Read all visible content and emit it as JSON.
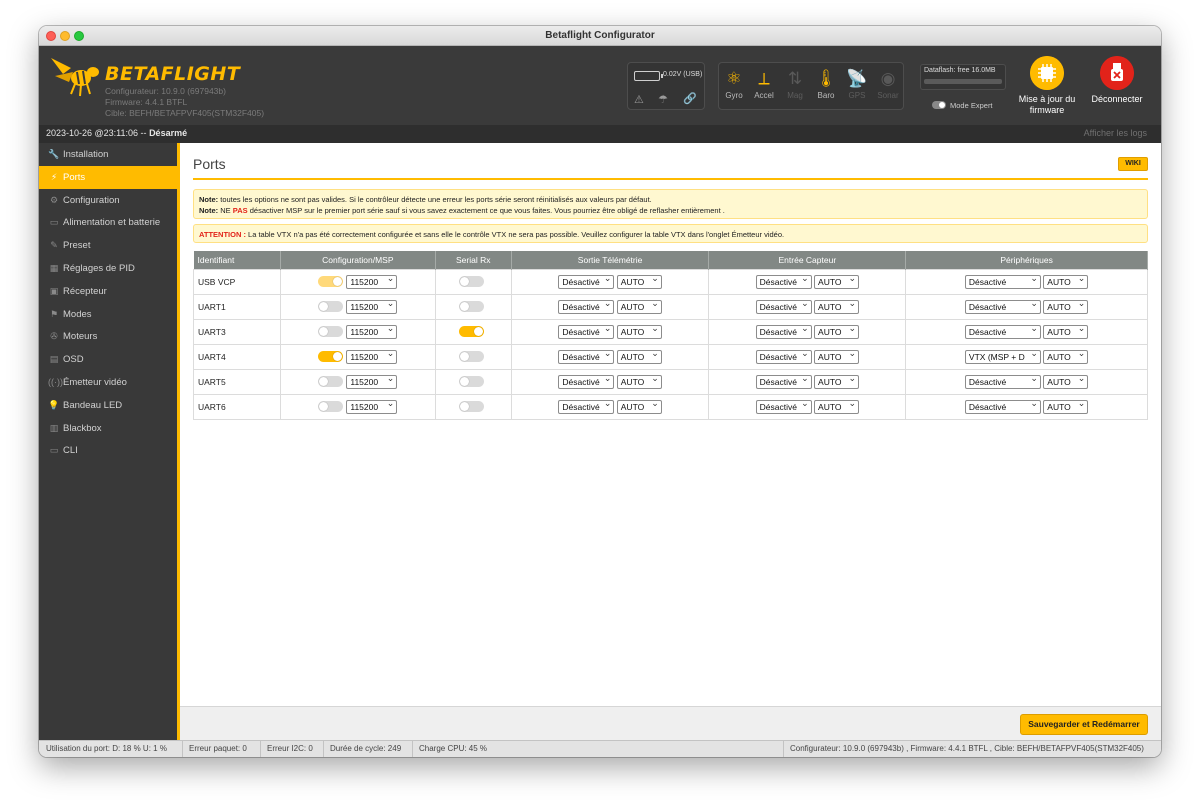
{
  "window": {
    "title": "Betaflight Configurator"
  },
  "header": {
    "logo_text": "BETAFLIGHT",
    "configurator_version": "Configurateur: 10.9.0 (697943b)",
    "firmware_version": "Firmware: 4.4.1 BTFL",
    "target": "Cible: BEFH/BETAFPVF405(STM32F405)",
    "battery": "0.02V (USB)",
    "sensors": [
      {
        "label": "Gyro",
        "icon": "gyro-icon",
        "active": true
      },
      {
        "label": "Accel",
        "icon": "accel-icon",
        "active": true
      },
      {
        "label": "Mag",
        "icon": "mag-icon",
        "active": false
      },
      {
        "label": "Baro",
        "icon": "baro-icon",
        "active": true
      },
      {
        "label": "GPS",
        "icon": "gps-icon",
        "active": false
      },
      {
        "label": "Sonar",
        "icon": "sonar-icon",
        "active": false
      }
    ],
    "dataflash": "Dataflash: free 16.0MB",
    "expert_mode": "Mode Expert",
    "flash_button": "Mise à jour du firmware",
    "disconnect_button": "Déconnecter"
  },
  "status_top": {
    "timestamp": "2023-10-26 @23:11:06 --",
    "arm_state": "Désarmé",
    "show_logs": "Afficher les logs"
  },
  "sidebar": {
    "items": [
      {
        "label": "Installation",
        "icon": "wrench-icon"
      },
      {
        "label": "Ports",
        "icon": "ports-icon",
        "active": true
      },
      {
        "label": "Configuration",
        "icon": "gear-icon"
      },
      {
        "label": "Alimentation et batterie",
        "icon": "battery-icon"
      },
      {
        "label": "Preset",
        "icon": "preset-icon"
      },
      {
        "label": "Réglages de PID",
        "icon": "pid-icon"
      },
      {
        "label": "Récepteur",
        "icon": "receiver-icon"
      },
      {
        "label": "Modes",
        "icon": "modes-icon"
      },
      {
        "label": "Moteurs",
        "icon": "motor-icon"
      },
      {
        "label": "OSD",
        "icon": "osd-icon"
      },
      {
        "label": "Émetteur vidéo",
        "icon": "vtx-icon"
      },
      {
        "label": "Bandeau LED",
        "icon": "led-icon"
      },
      {
        "label": "Blackbox",
        "icon": "blackbox-icon"
      },
      {
        "label": "CLI",
        "icon": "cli-icon"
      }
    ]
  },
  "page": {
    "title": "Ports",
    "wiki": "WIKI",
    "note1_label": "Note:",
    "note1_text": " toutes les options ne sont pas valides. Si le contrôleur détecte une erreur les ports série seront réinitialisés aux valeurs par défaut.",
    "note2_label": "Note:",
    "note2_pre": " NE ",
    "note2_emph": "PAS",
    "note2_text": " désactiver MSP sur le premier port série sauf si vous savez exactement ce que vous faites. Vous pourriez être obligé de reflasher entièrement .",
    "attention_label": "ATTENTION :",
    "attention_text": " La table VTX n'a pas été correctement configurée et sans elle le contrôle VTX ne sera pas possible. Veuillez configurer la table VTX dans l'onglet Émetteur vidéo.",
    "save_button": "Sauvegarder et Redémarrer"
  },
  "table": {
    "headers": [
      "Identifiant",
      "Configuration/MSP",
      "Serial Rx",
      "Sortie Télémétrie",
      "Entrée Capteur",
      "Périphériques"
    ],
    "rows": [
      {
        "id": "USB VCP",
        "msp": true,
        "msp_locked": true,
        "baud": "115200",
        "rx": false,
        "telemetry": "Désactivé",
        "telemetry_baud": "AUTO",
        "sensor": "Désactivé",
        "sensor_baud": "AUTO",
        "peripheral": "Désactivé",
        "peripheral_baud": "AUTO"
      },
      {
        "id": "UART1",
        "msp": false,
        "msp_locked": false,
        "baud": "115200",
        "rx": false,
        "telemetry": "Désactivé",
        "telemetry_baud": "AUTO",
        "sensor": "Désactivé",
        "sensor_baud": "AUTO",
        "peripheral": "Désactivé",
        "peripheral_baud": "AUTO"
      },
      {
        "id": "UART3",
        "msp": false,
        "msp_locked": false,
        "baud": "115200",
        "rx": true,
        "telemetry": "Désactivé",
        "telemetry_baud": "AUTO",
        "sensor": "Désactivé",
        "sensor_baud": "AUTO",
        "peripheral": "Désactivé",
        "peripheral_baud": "AUTO"
      },
      {
        "id": "UART4",
        "msp": true,
        "msp_locked": false,
        "baud": "115200",
        "rx": false,
        "telemetry": "Désactivé",
        "telemetry_baud": "AUTO",
        "sensor": "Désactivé",
        "sensor_baud": "AUTO",
        "peripheral": "VTX (MSP + D",
        "peripheral_baud": "AUTO"
      },
      {
        "id": "UART5",
        "msp": false,
        "msp_locked": false,
        "baud": "115200",
        "rx": false,
        "telemetry": "Désactivé",
        "telemetry_baud": "AUTO",
        "sensor": "Désactivé",
        "sensor_baud": "AUTO",
        "peripheral": "Désactivé",
        "peripheral_baud": "AUTO"
      },
      {
        "id": "UART6",
        "msp": false,
        "msp_locked": false,
        "baud": "115200",
        "rx": false,
        "telemetry": "Désactivé",
        "telemetry_baud": "AUTO",
        "sensor": "Désactivé",
        "sensor_baud": "AUTO",
        "peripheral": "Désactivé",
        "peripheral_baud": "AUTO"
      }
    ]
  },
  "bottom_bar": {
    "port_usage": "Utilisation du port: D: 18 % U: 1 %",
    "packet_error": "Erreur paquet: 0",
    "i2c_error": "Erreur I2C: 0",
    "cycle_time": "Durée de cycle: 249",
    "cpu_load": "Charge CPU: 45 %",
    "version_info": "Configurateur: 10.9.0 (697943b) , Firmware: 4.4.1 BTFL , Cible: BEFH/BETAFPVF405(STM32F405)"
  },
  "colors": {
    "accent": "#ffbb00",
    "danger": "#e2231a",
    "sidebar": "#393939",
    "header": "#3a3a3a"
  }
}
